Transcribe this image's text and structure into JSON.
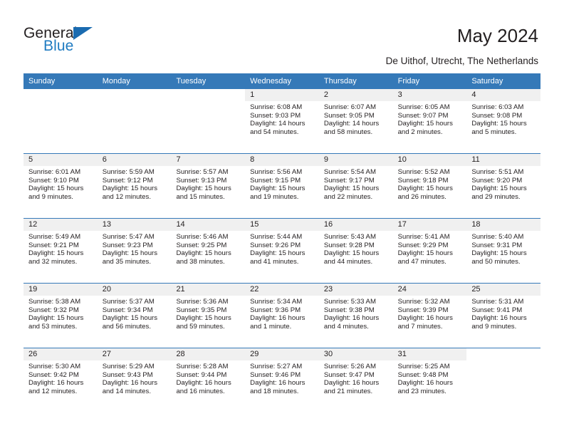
{
  "brand": {
    "name_top": "General",
    "name_bottom": "Blue",
    "accent_color": "#1f7bc1",
    "triangle_color": "#1a6bb0"
  },
  "header": {
    "title": "May 2024",
    "subtitle": "De Uithof, Utrecht, The Netherlands"
  },
  "calendar": {
    "header_bg": "#3579b8",
    "header_text_color": "#ffffff",
    "daycell_head_bg": "#f0f0f0",
    "weekdays": [
      "Sunday",
      "Monday",
      "Tuesday",
      "Wednesday",
      "Thursday",
      "Friday",
      "Saturday"
    ],
    "weeks": [
      [
        {
          "day": "",
          "lines": [],
          "blank": true
        },
        {
          "day": "",
          "lines": [],
          "blank": true
        },
        {
          "day": "",
          "lines": [],
          "blank": true
        },
        {
          "day": "1",
          "lines": [
            "Sunrise: 6:08 AM",
            "Sunset: 9:03 PM",
            "Daylight: 14 hours",
            "and 54 minutes."
          ]
        },
        {
          "day": "2",
          "lines": [
            "Sunrise: 6:07 AM",
            "Sunset: 9:05 PM",
            "Daylight: 14 hours",
            "and 58 minutes."
          ]
        },
        {
          "day": "3",
          "lines": [
            "Sunrise: 6:05 AM",
            "Sunset: 9:07 PM",
            "Daylight: 15 hours",
            "and 2 minutes."
          ]
        },
        {
          "day": "4",
          "lines": [
            "Sunrise: 6:03 AM",
            "Sunset: 9:08 PM",
            "Daylight: 15 hours",
            "and 5 minutes."
          ]
        }
      ],
      [
        {
          "day": "5",
          "lines": [
            "Sunrise: 6:01 AM",
            "Sunset: 9:10 PM",
            "Daylight: 15 hours",
            "and 9 minutes."
          ]
        },
        {
          "day": "6",
          "lines": [
            "Sunrise: 5:59 AM",
            "Sunset: 9:12 PM",
            "Daylight: 15 hours",
            "and 12 minutes."
          ]
        },
        {
          "day": "7",
          "lines": [
            "Sunrise: 5:57 AM",
            "Sunset: 9:13 PM",
            "Daylight: 15 hours",
            "and 15 minutes."
          ]
        },
        {
          "day": "8",
          "lines": [
            "Sunrise: 5:56 AM",
            "Sunset: 9:15 PM",
            "Daylight: 15 hours",
            "and 19 minutes."
          ]
        },
        {
          "day": "9",
          "lines": [
            "Sunrise: 5:54 AM",
            "Sunset: 9:17 PM",
            "Daylight: 15 hours",
            "and 22 minutes."
          ]
        },
        {
          "day": "10",
          "lines": [
            "Sunrise: 5:52 AM",
            "Sunset: 9:18 PM",
            "Daylight: 15 hours",
            "and 26 minutes."
          ]
        },
        {
          "day": "11",
          "lines": [
            "Sunrise: 5:51 AM",
            "Sunset: 9:20 PM",
            "Daylight: 15 hours",
            "and 29 minutes."
          ]
        }
      ],
      [
        {
          "day": "12",
          "lines": [
            "Sunrise: 5:49 AM",
            "Sunset: 9:21 PM",
            "Daylight: 15 hours",
            "and 32 minutes."
          ]
        },
        {
          "day": "13",
          "lines": [
            "Sunrise: 5:47 AM",
            "Sunset: 9:23 PM",
            "Daylight: 15 hours",
            "and 35 minutes."
          ]
        },
        {
          "day": "14",
          "lines": [
            "Sunrise: 5:46 AM",
            "Sunset: 9:25 PM",
            "Daylight: 15 hours",
            "and 38 minutes."
          ]
        },
        {
          "day": "15",
          "lines": [
            "Sunrise: 5:44 AM",
            "Sunset: 9:26 PM",
            "Daylight: 15 hours",
            "and 41 minutes."
          ]
        },
        {
          "day": "16",
          "lines": [
            "Sunrise: 5:43 AM",
            "Sunset: 9:28 PM",
            "Daylight: 15 hours",
            "and 44 minutes."
          ]
        },
        {
          "day": "17",
          "lines": [
            "Sunrise: 5:41 AM",
            "Sunset: 9:29 PM",
            "Daylight: 15 hours",
            "and 47 minutes."
          ]
        },
        {
          "day": "18",
          "lines": [
            "Sunrise: 5:40 AM",
            "Sunset: 9:31 PM",
            "Daylight: 15 hours",
            "and 50 minutes."
          ]
        }
      ],
      [
        {
          "day": "19",
          "lines": [
            "Sunrise: 5:38 AM",
            "Sunset: 9:32 PM",
            "Daylight: 15 hours",
            "and 53 minutes."
          ]
        },
        {
          "day": "20",
          "lines": [
            "Sunrise: 5:37 AM",
            "Sunset: 9:34 PM",
            "Daylight: 15 hours",
            "and 56 minutes."
          ]
        },
        {
          "day": "21",
          "lines": [
            "Sunrise: 5:36 AM",
            "Sunset: 9:35 PM",
            "Daylight: 15 hours",
            "and 59 minutes."
          ]
        },
        {
          "day": "22",
          "lines": [
            "Sunrise: 5:34 AM",
            "Sunset: 9:36 PM",
            "Daylight: 16 hours",
            "and 1 minute."
          ]
        },
        {
          "day": "23",
          "lines": [
            "Sunrise: 5:33 AM",
            "Sunset: 9:38 PM",
            "Daylight: 16 hours",
            "and 4 minutes."
          ]
        },
        {
          "day": "24",
          "lines": [
            "Sunrise: 5:32 AM",
            "Sunset: 9:39 PM",
            "Daylight: 16 hours",
            "and 7 minutes."
          ]
        },
        {
          "day": "25",
          "lines": [
            "Sunrise: 5:31 AM",
            "Sunset: 9:41 PM",
            "Daylight: 16 hours",
            "and 9 minutes."
          ]
        }
      ],
      [
        {
          "day": "26",
          "lines": [
            "Sunrise: 5:30 AM",
            "Sunset: 9:42 PM",
            "Daylight: 16 hours",
            "and 12 minutes."
          ]
        },
        {
          "day": "27",
          "lines": [
            "Sunrise: 5:29 AM",
            "Sunset: 9:43 PM",
            "Daylight: 16 hours",
            "and 14 minutes."
          ]
        },
        {
          "day": "28",
          "lines": [
            "Sunrise: 5:28 AM",
            "Sunset: 9:44 PM",
            "Daylight: 16 hours",
            "and 16 minutes."
          ]
        },
        {
          "day": "29",
          "lines": [
            "Sunrise: 5:27 AM",
            "Sunset: 9:46 PM",
            "Daylight: 16 hours",
            "and 18 minutes."
          ]
        },
        {
          "day": "30",
          "lines": [
            "Sunrise: 5:26 AM",
            "Sunset: 9:47 PM",
            "Daylight: 16 hours",
            "and 21 minutes."
          ]
        },
        {
          "day": "31",
          "lines": [
            "Sunrise: 5:25 AM",
            "Sunset: 9:48 PM",
            "Daylight: 16 hours",
            "and 23 minutes."
          ]
        },
        {
          "day": "",
          "lines": [],
          "blank": true
        }
      ]
    ]
  }
}
